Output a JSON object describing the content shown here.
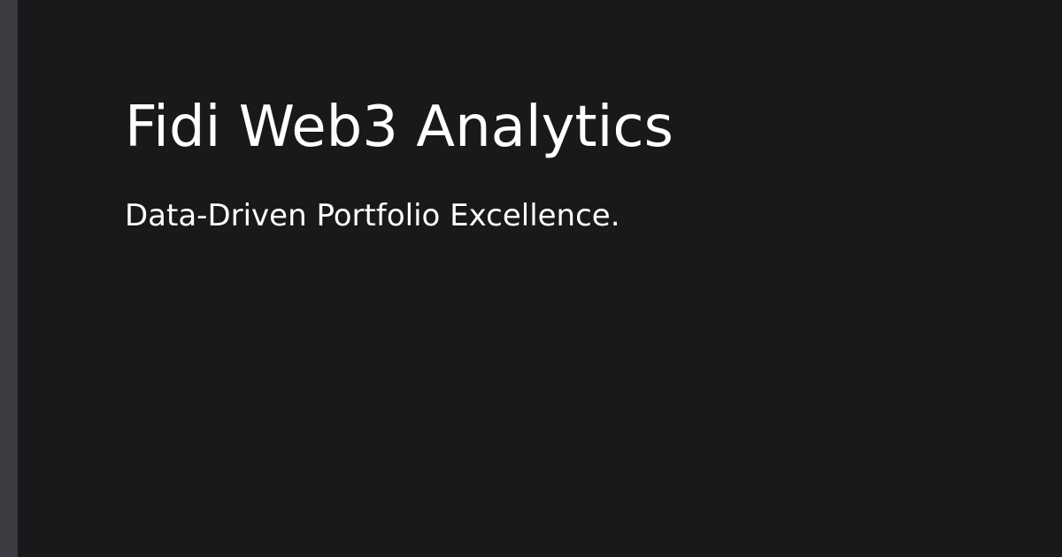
{
  "card": {
    "title": "Fidi Web3 Analytics",
    "subtitle": "Data-Driven Portfolio Excellence."
  },
  "colors": {
    "background": "#19191b",
    "accent_bar": "#3b3b42",
    "text": "#ffffff"
  }
}
